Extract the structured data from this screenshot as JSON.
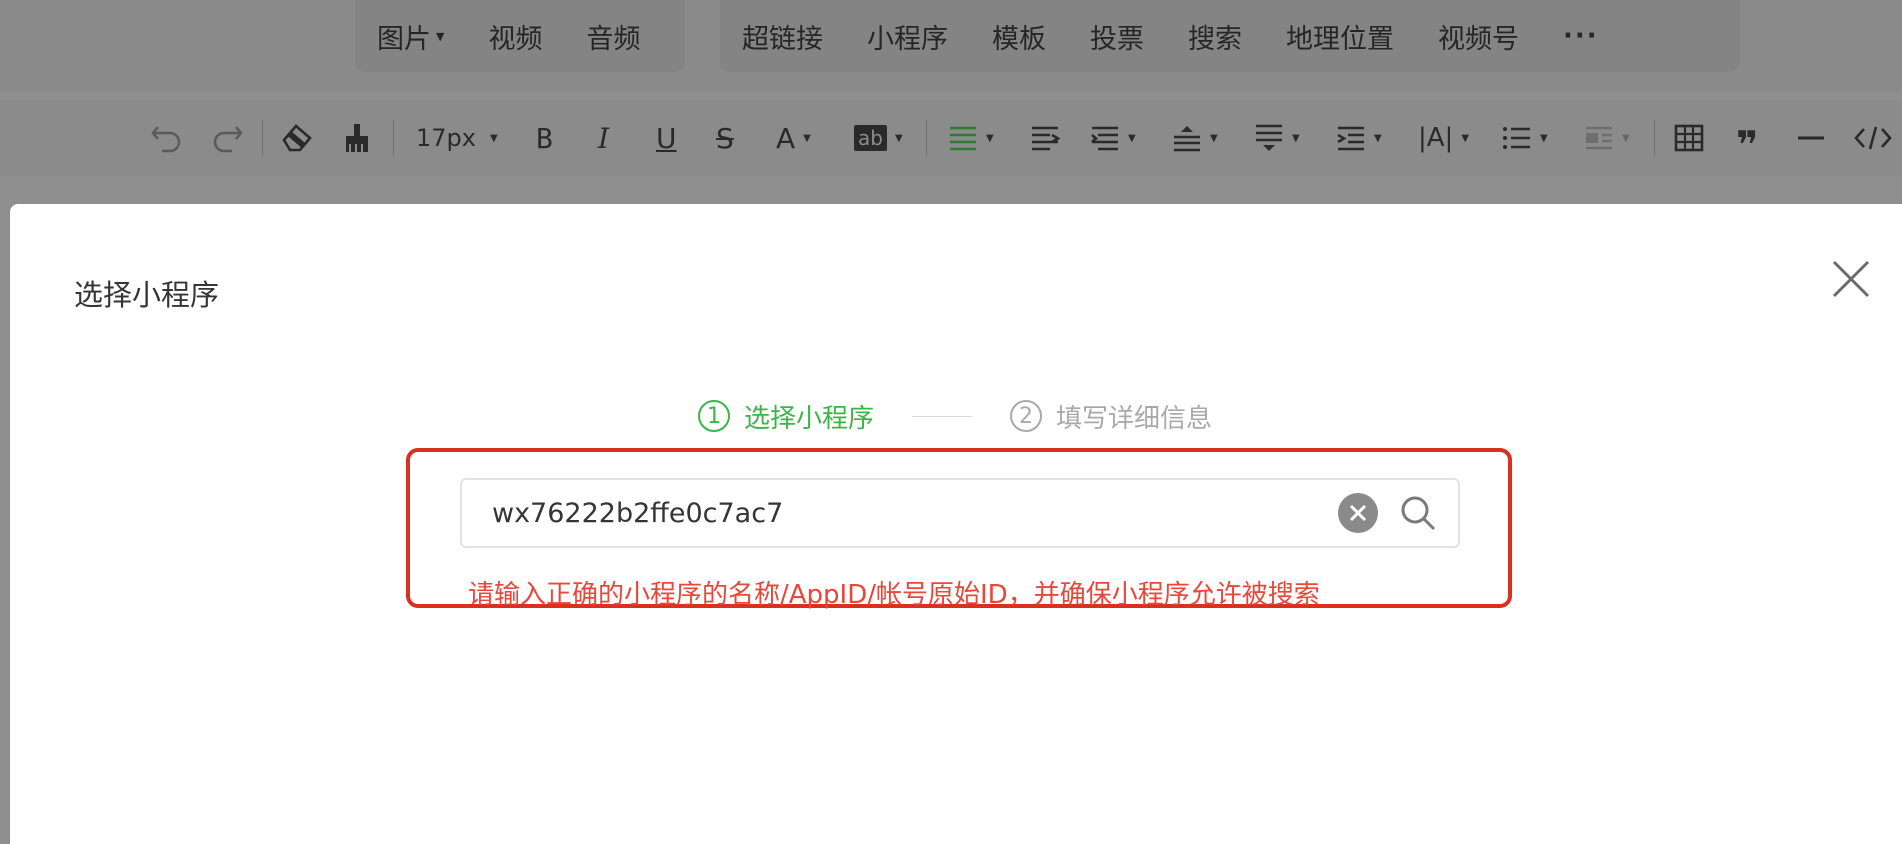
{
  "insert_bar": {
    "group1": [
      {
        "label": "图片",
        "has_dropdown": true
      },
      {
        "label": "视频",
        "has_dropdown": false
      },
      {
        "label": "音频",
        "has_dropdown": false
      }
    ],
    "group2": [
      {
        "label": "超链接"
      },
      {
        "label": "小程序"
      },
      {
        "label": "模板"
      },
      {
        "label": "投票"
      },
      {
        "label": "搜索"
      },
      {
        "label": "地理位置"
      },
      {
        "label": "视频号"
      }
    ],
    "more_label": "···"
  },
  "format_bar": {
    "font_size": "17px",
    "bold": "B",
    "italic": "I",
    "underline": "U",
    "strike": "S",
    "font_color": "A",
    "highlight": "ab",
    "line_height": "|A|",
    "icons": [
      "undo-icon",
      "redo-icon",
      "eraser-icon",
      "format-painter-icon",
      "align-left-icon",
      "indent-icon",
      "justify-icon",
      "vertical-align-icon",
      "spacing-before-icon",
      "spacing-after-icon",
      "bullet-list-icon",
      "float-icon",
      "table-icon",
      "quote-icon",
      "divider-icon",
      "code-icon"
    ]
  },
  "dialog": {
    "title": "选择小程序",
    "steps": [
      {
        "number": "1",
        "label": "选择小程序",
        "state": "active"
      },
      {
        "number": "2",
        "label": "填写详细信息",
        "state": "inactive"
      }
    ],
    "search": {
      "value": "wx76222b2ffe0c7ac7",
      "placeholder": ""
    },
    "error_message": "请输入正确的小程序的名称/AppID/帐号原始ID，并确保小程序允许被搜索"
  },
  "colors": {
    "accent_green": "#3bb54a",
    "error_red": "#e8473a",
    "highlight_border": "#d9301f"
  }
}
